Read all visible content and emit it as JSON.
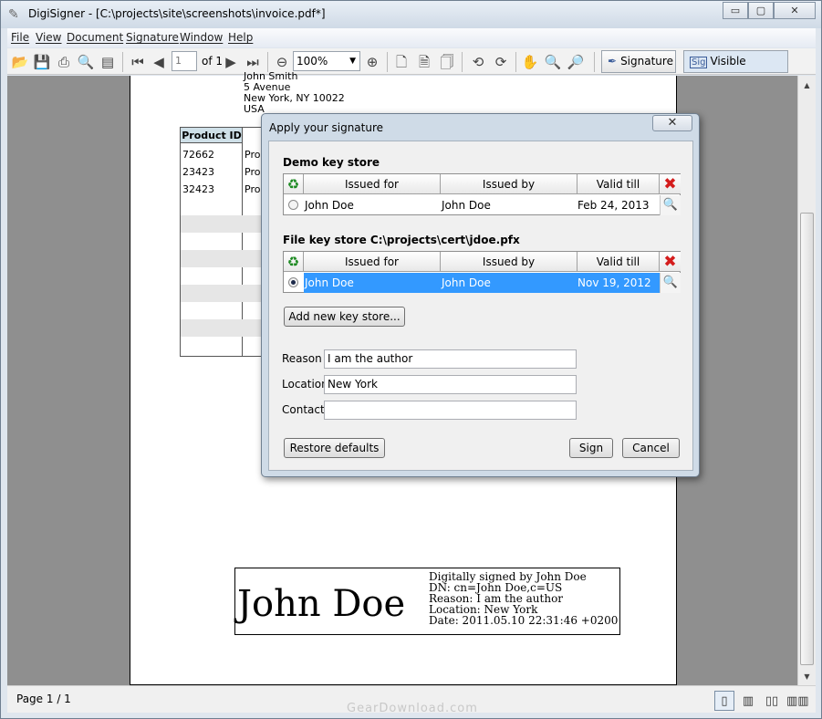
{
  "window": {
    "title": "DigiSigner - [C:\\projects\\site\\screenshots\\invoice.pdf*]"
  },
  "window_controls": {
    "minimize": "▭",
    "maximize": "▢",
    "close": "✕"
  },
  "menu": [
    "File",
    "View",
    "Document",
    "Signature",
    "Window",
    "Help"
  ],
  "toolbar": {
    "page_value": "1",
    "page_of": "of 1",
    "zoom": "100%",
    "signature_label": "Signature",
    "visible_signature_label": "Visible Signature"
  },
  "document": {
    "address": [
      "John Smith",
      "5 Avenue",
      "New York, NY 10022",
      "USA"
    ],
    "table_header": "Product ID",
    "rows": [
      {
        "id": "72662",
        "product": "Prod"
      },
      {
        "id": "23423",
        "product": "Prod"
      },
      {
        "id": "32423",
        "product": "Prod"
      }
    ],
    "signature": {
      "name": "John Doe",
      "lines": [
        "Digitally signed by John Doe",
        "DN: cn=John Doe,c=US",
        "Reason: I am the author",
        "Location: New York",
        "Date: 2011.05.10 22:31:46 +0200"
      ]
    }
  },
  "dialog": {
    "title": "Apply your signature",
    "demo_store": {
      "title": "Demo key store",
      "headers": [
        "Issued for",
        "Issued by",
        "Valid till"
      ],
      "row": {
        "issued_for": "John Doe",
        "issued_by": "John Doe",
        "valid_till": "Feb 24, 2013"
      }
    },
    "file_store": {
      "title": "File key store C:\\projects\\cert\\jdoe.pfx",
      "headers": [
        "Issued for",
        "Issued by",
        "Valid till"
      ],
      "row": {
        "issued_for": "John Doe",
        "issued_by": "John Doe",
        "valid_till": "Nov 19, 2012"
      }
    },
    "add_button": "Add new key store...",
    "reason_label": "Reason",
    "reason_value": "I am the author",
    "location_label": "Location",
    "location_value": "New York",
    "contact_label": "Contact",
    "contact_value": "",
    "restore_button": "Restore defaults",
    "sign_button": "Sign",
    "cancel_button": "Cancel"
  },
  "status": {
    "page": "Page 1 / 1"
  },
  "watermark": "GearDownload.com",
  "colors": {
    "selection": "#3399ff",
    "delete": "#d41c1c",
    "refresh": "#1d8a22"
  }
}
